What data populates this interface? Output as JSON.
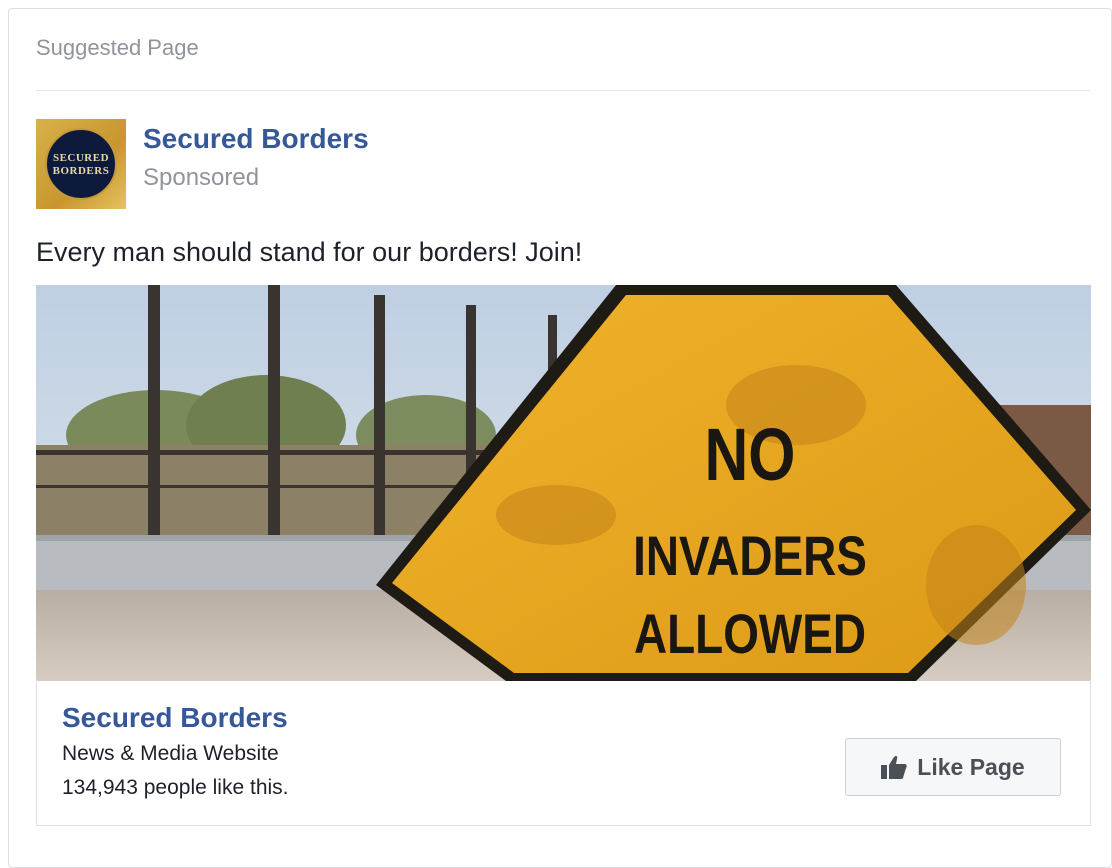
{
  "header": {
    "label": "Suggested Page"
  },
  "page": {
    "name": "Secured Borders",
    "status": "Sponsored",
    "avatar_text": [
      "SECURED",
      "BORDERS"
    ]
  },
  "post": {
    "text": "Every man should stand for our borders! Join!",
    "image_sign_lines": [
      "NO",
      "INVADERS",
      "ALLOWED"
    ]
  },
  "link": {
    "title": "Secured Borders",
    "category": "News & Media Website",
    "likes": "134,943 people like this.",
    "button_label": "Like Page"
  },
  "icons": {
    "like_button_icon": "thumbs-up-icon"
  },
  "colors": {
    "link_blue": "#365899",
    "muted_gray": "#90949c",
    "sign_yellow": "#e9a51c"
  }
}
